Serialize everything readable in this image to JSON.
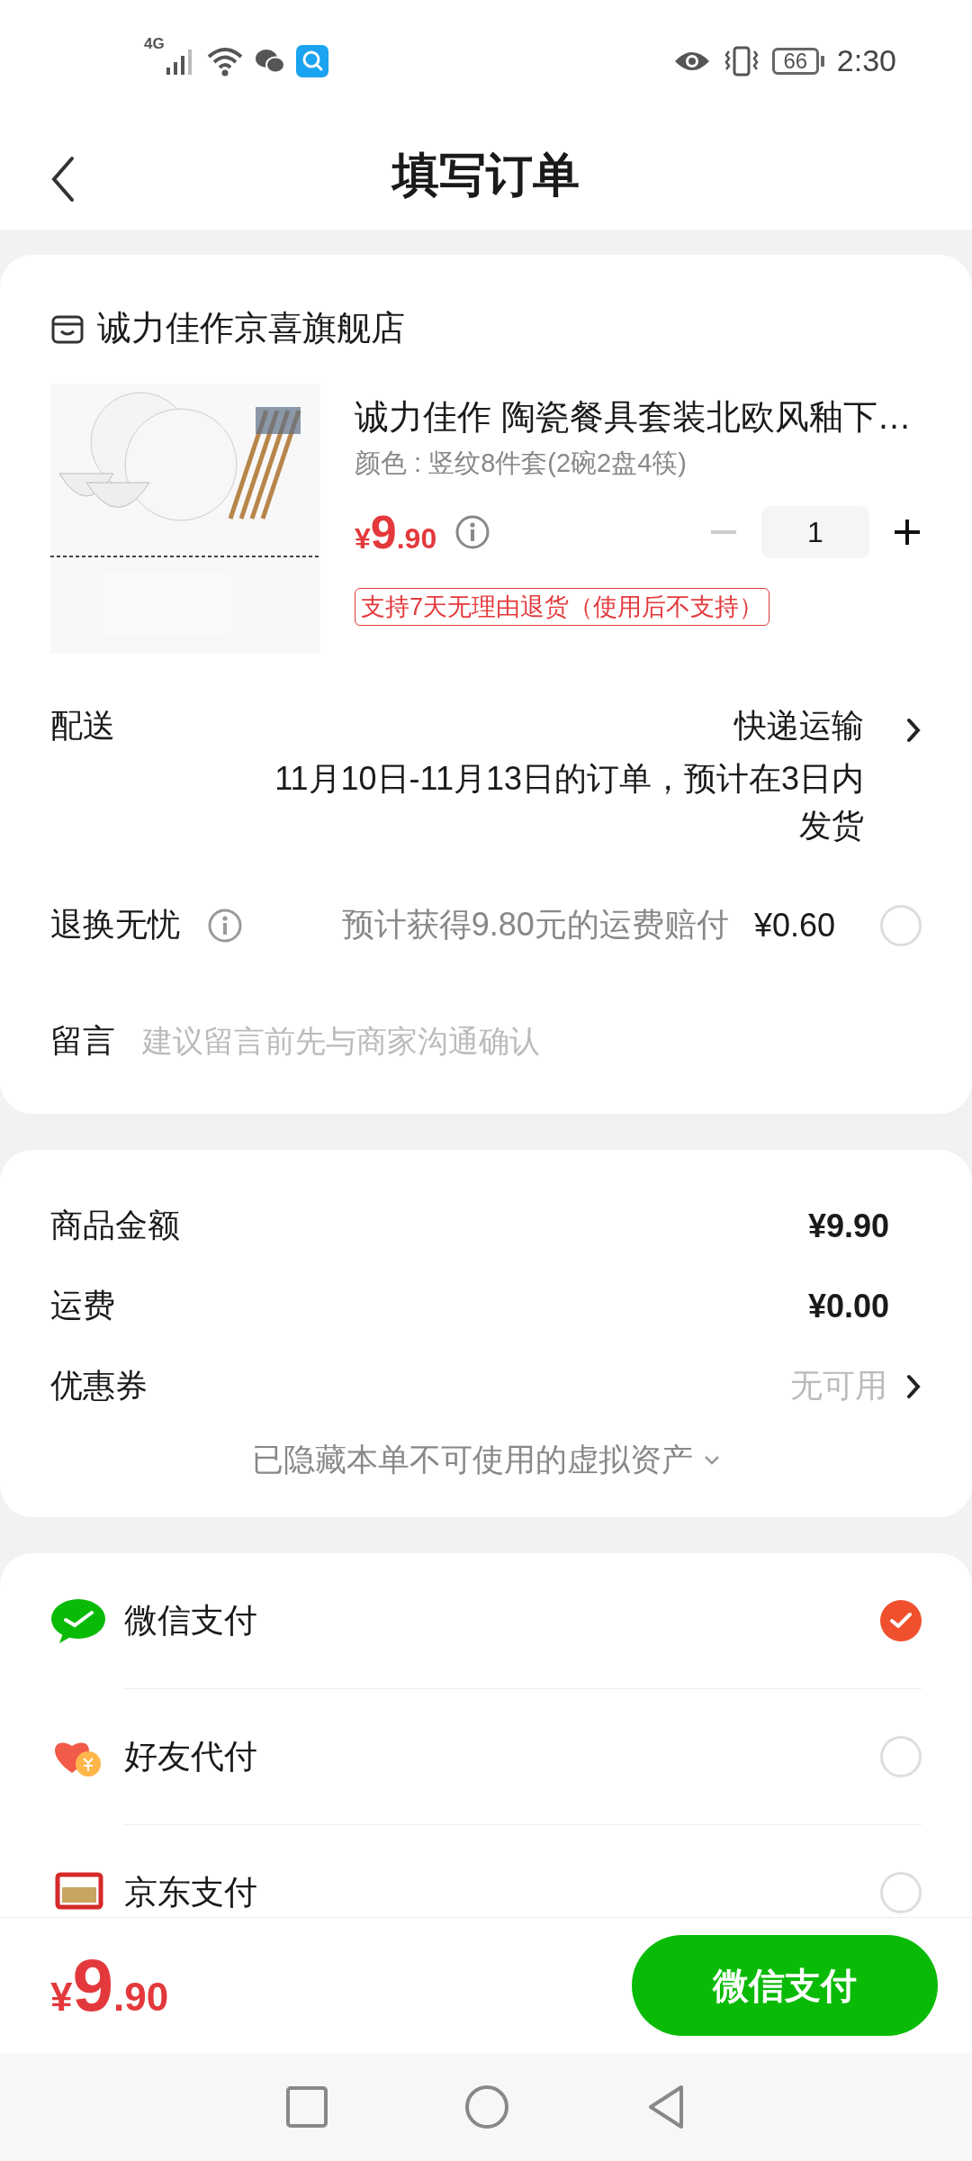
{
  "status_bar": {
    "network": "4G",
    "battery": "66",
    "time": "2:30"
  },
  "header": {
    "title": "填写订单"
  },
  "store": {
    "name": "诚力佳作京喜旗舰店"
  },
  "product": {
    "title": "诚力佳作 陶瓷餐具套装北欧风釉下…",
    "variant": "颜色 : 竖纹8件套(2碗2盘4筷)",
    "price_symbol": "¥",
    "price_int": "9",
    "price_dec": ".90",
    "quantity": "1",
    "return_tag": "支持7天无理由退货（使用后不支持）"
  },
  "delivery": {
    "label": "配送",
    "method": "快递运输",
    "note": "11月10日-11月13日的订单，预计在3日内发货"
  },
  "insurance": {
    "label": "退换无忧",
    "note": "预计获得9.80元的运费赔付",
    "price": "¥0.60",
    "checked": false
  },
  "message": {
    "label": "留言",
    "placeholder": "建议留言前先与商家沟通确认"
  },
  "summary": {
    "rows": [
      {
        "label": "商品金额",
        "value": "¥9.90",
        "kind": "amount"
      },
      {
        "label": "运费",
        "value": "¥0.00",
        "kind": "amount"
      },
      {
        "label": "优惠券",
        "value": "无可用",
        "kind": "link"
      }
    ],
    "hidden_note": "已隐藏本单不可使用的虚拟资产"
  },
  "payment": [
    {
      "name": "微信支付",
      "kind": "wechat",
      "selected": true
    },
    {
      "name": "好友代付",
      "kind": "friend",
      "selected": false
    },
    {
      "name": "京东支付",
      "kind": "card",
      "selected": false
    }
  ],
  "footer": {
    "price_symbol": "¥",
    "price_int": "9",
    "price_dec": ".90",
    "pay_button": "微信支付"
  }
}
